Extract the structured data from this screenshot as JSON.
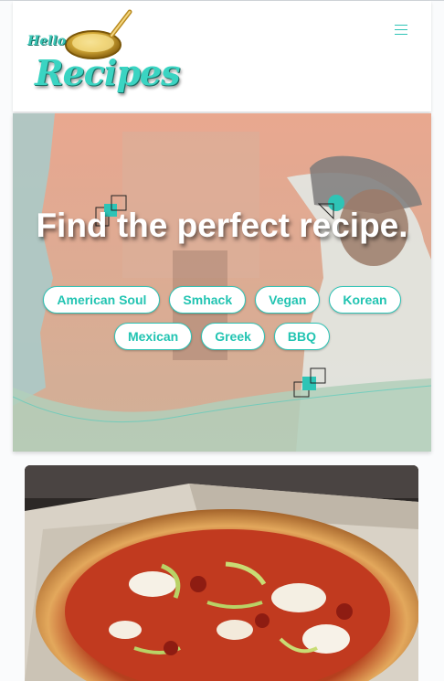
{
  "header": {
    "logo_alt": "Hello Recipes",
    "logo_small": "Hello",
    "logo_large": "Recipes",
    "menu_icon": "hamburger-icon"
  },
  "hero": {
    "title": "Find the perfect recipe.",
    "tags": [
      "American Soul",
      "Smhack",
      "Vegan",
      "Korean",
      "Mexican",
      "Greek",
      "BBQ"
    ]
  },
  "colors": {
    "accent": "#2ec4b6",
    "tag_bg": "#ffffff"
  },
  "card": {
    "image_alt": "Pizza in a box"
  }
}
